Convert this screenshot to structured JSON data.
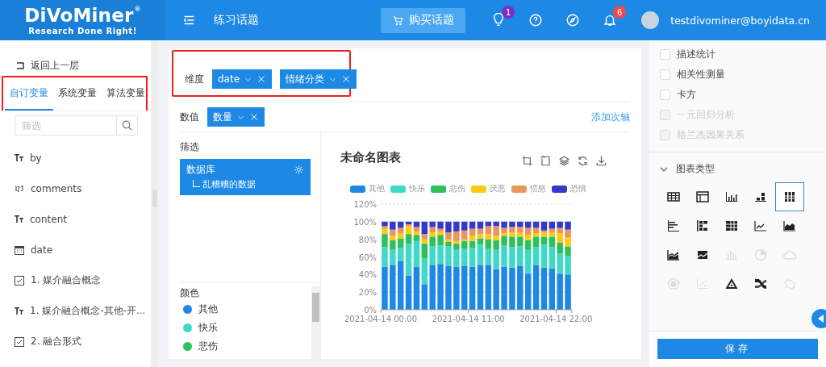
{
  "header": {
    "logo": "DiVoMiner",
    "logo_mark": "®",
    "tagline": "Research Done Right!",
    "title": "练习话题",
    "buy_button": "购买话题",
    "tips_badge": "1",
    "notice_badge": "6",
    "user_email": "testdivominer@boyidata.cn"
  },
  "sidebar": {
    "back": "返回上一层",
    "tabs_highlighted": true,
    "tabs": [
      {
        "label": "自订变量",
        "selected": true
      },
      {
        "label": "系统变量",
        "selected": false
      },
      {
        "label": "算法变量",
        "selected": false
      }
    ],
    "search": {
      "placeholder": "筛选"
    },
    "items": [
      {
        "kind": "text",
        "label": "by"
      },
      {
        "kind": "number",
        "label": "comments"
      },
      {
        "kind": "text",
        "label": "content"
      },
      {
        "kind": "date",
        "label": "date"
      },
      {
        "kind": "choice",
        "label": "1. 媒介融合概念"
      },
      {
        "kind": "text",
        "label": "1. 媒介融合概念-其他-开..."
      },
      {
        "kind": "choice",
        "label": "2. 融合形式"
      }
    ]
  },
  "dimension": {
    "label": "维度",
    "highlighted": true,
    "chips": [
      "date",
      "情绪分类"
    ]
  },
  "value": {
    "label": "数值",
    "chips": [
      "数量"
    ],
    "link": "添加次轴"
  },
  "filter": {
    "label": "筛选",
    "source": "数据库",
    "dataset": "乱糟糟的数据"
  },
  "color": {
    "label": "颜色",
    "items": [
      {
        "label": "其他",
        "color": "#1e88e5"
      },
      {
        "label": "快乐",
        "color": "#3fd9c9"
      },
      {
        "label": "悲伤",
        "color": "#2ec05a"
      }
    ]
  },
  "chart": {
    "title": "未命名图表",
    "chart_data": {
      "type": "bar",
      "stacked": true,
      "grid": true,
      "categories": [
        "2021-04-14 00:00",
        null,
        null,
        null,
        null,
        null,
        null,
        null,
        null,
        null,
        null,
        "2021-04-14 11:00",
        null,
        null,
        null,
        null,
        null,
        null,
        null,
        null,
        null,
        null,
        "2021-04-14 22:00",
        null
      ],
      "ylim": [
        0,
        1.2
      ],
      "yticks": [
        {
          "value": 0,
          "label": "0%"
        },
        {
          "value": 0.2,
          "label": "20%"
        },
        {
          "value": 0.4,
          "label": "40%"
        },
        {
          "value": 0.6,
          "label": "60%"
        },
        {
          "value": 0.8,
          "label": "80%"
        },
        {
          "value": 1,
          "label": "100%"
        },
        {
          "value": 1.2,
          "label": "120%"
        }
      ],
      "series": [
        {
          "name": "其他",
          "color": "#1e88e5",
          "values": [
            0.49,
            0.51,
            0.55,
            0.39,
            0.49,
            0.29,
            0.51,
            0.52,
            0.5,
            0.49,
            0.5,
            0.49,
            0.51,
            0.51,
            0.46,
            0.49,
            0.48,
            0.5,
            0.41,
            0.51,
            0.48,
            0.47,
            0.41,
            0.4
          ]
        },
        {
          "name": "快乐",
          "color": "#3fd9c9",
          "values": [
            0.22,
            0.17,
            0.15,
            0.36,
            0.29,
            0.29,
            0.21,
            0.21,
            0.22,
            0.19,
            0.19,
            0.21,
            0.23,
            0.18,
            0.22,
            0.24,
            0.23,
            0.22,
            0.27,
            0.2,
            0.26,
            0.24,
            0.23,
            0.21
          ]
        },
        {
          "name": "悲伤",
          "color": "#2ec05a",
          "values": [
            0.15,
            0.11,
            0.11,
            0.11,
            0.07,
            0.17,
            0.11,
            0.12,
            0.05,
            0.07,
            0.09,
            0.08,
            0.07,
            0.11,
            0.11,
            0.11,
            0.12,
            0.11,
            0.11,
            0.12,
            0.09,
            0.12,
            0.12,
            0.11
          ]
        },
        {
          "name": "厌恶",
          "color": "#fccb16",
          "values": [
            0.06,
            0.05,
            0.06,
            0.09,
            0.04,
            0.05,
            0.05,
            0.04,
            0.03,
            0.03,
            0.02,
            0.06,
            0.05,
            0.06,
            0.05,
            0.03,
            0.05,
            0.05,
            0.06,
            0.04,
            0.05,
            0.05,
            0.11,
            0.1
          ]
        },
        {
          "name": "愤怒",
          "color": "#e9955e",
          "values": [
            0.03,
            0.07,
            0.06,
            0.02,
            0.05,
            0.06,
            0.06,
            0.03,
            0.08,
            0.11,
            0.1,
            0.08,
            0.06,
            0.09,
            0.11,
            0.06,
            0.06,
            0.06,
            0.08,
            0.06,
            0.02,
            0.04,
            0.06,
            0.09
          ]
        },
        {
          "name": "恐惧",
          "color": "#3339c9",
          "values": [
            0.05,
            0.09,
            0.07,
            0.03,
            0.06,
            0.14,
            0.06,
            0.08,
            0.12,
            0.11,
            0.1,
            0.08,
            0.08,
            0.05,
            0.05,
            0.07,
            0.06,
            0.06,
            0.07,
            0.07,
            0.1,
            0.08,
            0.07,
            0.09
          ]
        }
      ]
    }
  },
  "analysis": [
    {
      "label": "描述统计",
      "checked": false,
      "disabled": false
    },
    {
      "label": "相关性测量",
      "checked": false,
      "disabled": false
    },
    {
      "label": "卡方",
      "checked": false,
      "disabled": false
    },
    {
      "label": "一元回归分析",
      "checked": false,
      "disabled": true
    },
    {
      "label": "格兰杰因果关系",
      "checked": false,
      "disabled": true
    }
  ],
  "chart_types": {
    "label": "图表类型",
    "expanded": true,
    "items": [
      {
        "kind": "table",
        "selected": false,
        "disabled": false
      },
      {
        "kind": "pivot",
        "selected": false,
        "disabled": false
      },
      {
        "kind": "column",
        "selected": false,
        "disabled": false
      },
      {
        "kind": "stacked",
        "selected": false,
        "disabled": false
      },
      {
        "kind": "percent",
        "selected": true,
        "disabled": false
      },
      {
        "kind": "hbar",
        "selected": false,
        "disabled": false
      },
      {
        "kind": "hstacked",
        "selected": false,
        "disabled": false
      },
      {
        "kind": "hpercent",
        "selected": false,
        "disabled": false
      },
      {
        "kind": "line",
        "selected": false,
        "disabled": false
      },
      {
        "kind": "area",
        "selected": false,
        "disabled": false
      },
      {
        "kind": "stackarea",
        "selected": false,
        "disabled": false
      },
      {
        "kind": "percentarea",
        "selected": false,
        "disabled": false
      },
      {
        "kind": "histogram",
        "selected": false,
        "disabled": true
      },
      {
        "kind": "pie",
        "selected": false,
        "disabled": true
      },
      {
        "kind": "cloud",
        "selected": false,
        "disabled": true
      },
      {
        "kind": "radar",
        "selected": false,
        "disabled": true
      },
      {
        "kind": "scatter",
        "selected": false,
        "disabled": true
      },
      {
        "kind": "funnel",
        "selected": false,
        "disabled": false
      },
      {
        "kind": "sankey",
        "selected": false,
        "disabled": false
      },
      {
        "kind": "map",
        "selected": false,
        "disabled": true
      }
    ]
  },
  "save_button": "保存"
}
